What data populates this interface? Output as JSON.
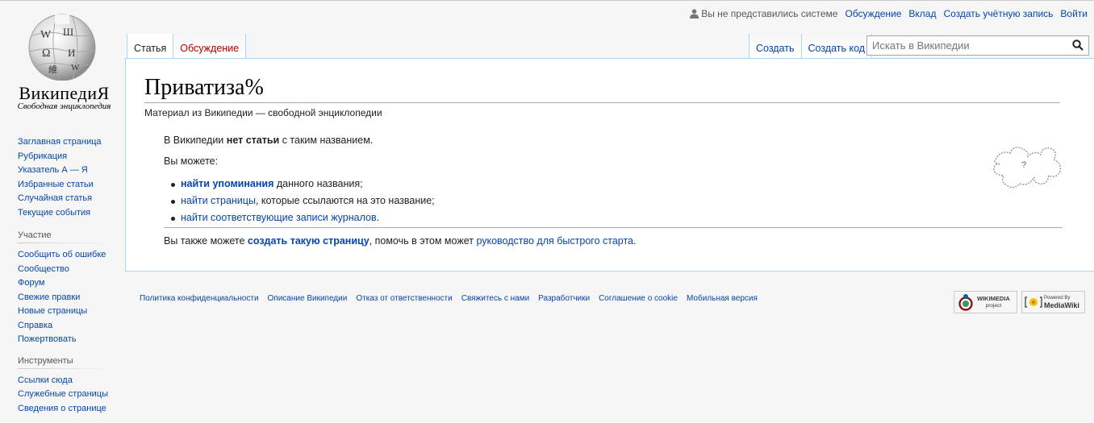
{
  "logo": {
    "wordmark": "ВикипедиЯ",
    "tagline": "Свободная энциклопедия"
  },
  "personal": {
    "anon": "Вы не представились системе",
    "talk": "Обсуждение",
    "login": "Вклад",
    "create_account": "Создать учётную запись",
    "logout": "Войти"
  },
  "tabs": {
    "left": [
      {
        "label": "Статья"
      },
      {
        "label": "Обсуждение"
      }
    ],
    "right": [
      {
        "label": "Создать"
      },
      {
        "label": "Создать код"
      }
    ]
  },
  "search": {
    "placeholder": "Искать в Википедии"
  },
  "content": {
    "title": "Приватиза%",
    "site_sub": "Материал из Википедии — свободной энциклопедии",
    "notice_pre": "В Википедии ",
    "notice_bold": "нет статьи",
    "notice_post": " с таким названием.",
    "you_can": "Вы можете:",
    "options": [
      {
        "link": "найти упоминания",
        "rest": " данного названия;"
      },
      {
        "link": "найти страницы",
        "rest": ", которые ссылаются на это название;"
      },
      {
        "link": "найти соответствующие записи журналов",
        "rest": "."
      }
    ],
    "also_pre": "Вы также можете ",
    "also_link": "создать такую страницу",
    "also_mid": ", помочь в этом может ",
    "also_link2": "руководство для быстрого старта",
    "also_end": "."
  },
  "sidebar": {
    "nav": [
      "Заглавная страница",
      "Рубрикация",
      "Указатель А — Я",
      "Избранные статьи",
      "Случайная статья",
      "Текущие события"
    ],
    "participation_title": "Участие",
    "participation": [
      "Сообщить об ошибке",
      "Сообщество",
      "Форум",
      "Свежие правки",
      "Новые страницы",
      "Справка",
      "Пожертвовать"
    ],
    "tools_title": "Инструменты",
    "tools": [
      "Ссылки сюда",
      "Служебные страницы",
      "Сведения о странице"
    ]
  },
  "footer": {
    "links": [
      "Политика конфиденциальности",
      "Описание Википедии",
      "Отказ от ответственности",
      "Свяжитесь с нами",
      "Разработчики",
      "Соглашение о cookie",
      "Мобильная версия"
    ],
    "wikimedia_badge": "WIKIMEDIA",
    "wikimedia_badge_sub": "project",
    "mediawiki_badge_top": "Powered By",
    "mediawiki_badge": "MediaWiki"
  }
}
